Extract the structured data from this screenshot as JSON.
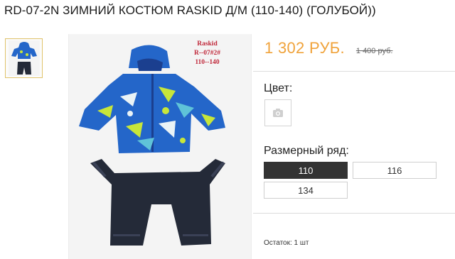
{
  "product": {
    "title": "RD-07-2N ЗИМНИЙ КОСТЮМ RASKID Д/М (110-140) (ГОЛУБОЙ))",
    "price": "1 302 РУБ.",
    "old_price": "1 400 руб.",
    "tag_lines": [
      "Raskid",
      "R--07#2#",
      "110--140"
    ]
  },
  "options": {
    "color_label": "Цвет:",
    "color_swatch_icon": "camera-placeholder-icon",
    "size_label": "Размерный ряд:",
    "sizes": [
      {
        "label": "110",
        "selected": true
      },
      {
        "label": "116",
        "selected": false
      },
      {
        "label": "134",
        "selected": false
      }
    ]
  },
  "stock": "Остаток: 1 шт",
  "colors": {
    "price": "#f0a33b",
    "tag": "#c0283a",
    "jacket": "#2466c9",
    "accent": "#c7e63a",
    "pants": "#242a38",
    "selected_bg": "#333333"
  }
}
